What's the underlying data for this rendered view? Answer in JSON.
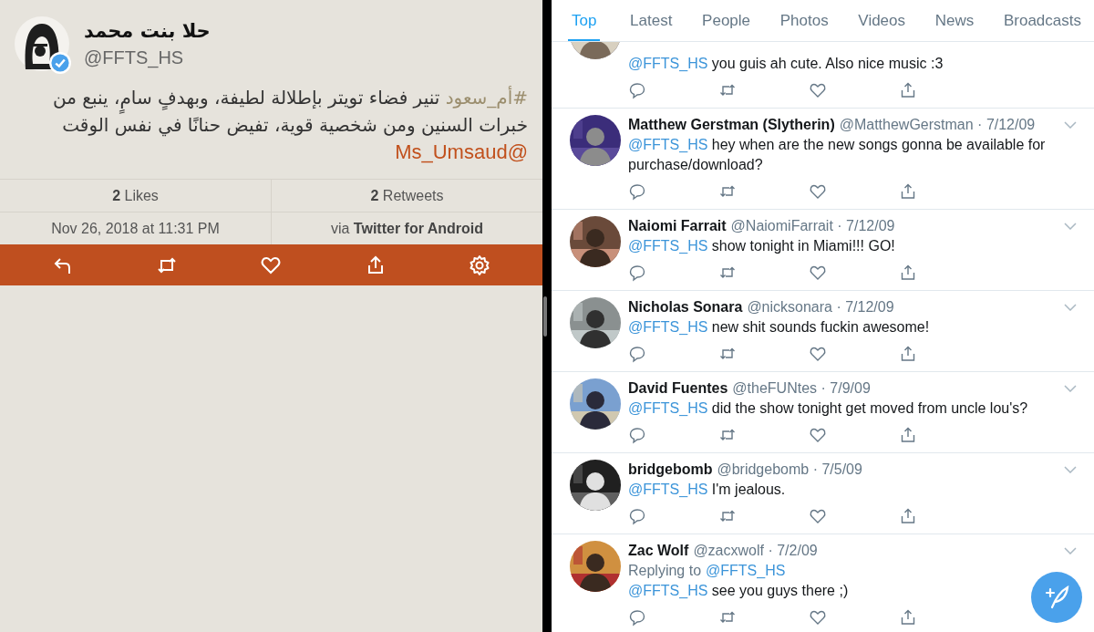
{
  "detail": {
    "name": "حلا بنت محمد",
    "handle": "@FFTS_HS",
    "verified": true,
    "hashtag": "#أم_سعود",
    "text": "تنير فضاء تويتر بإطلالة لطيفة، وبهدفٍ سامٍ، ينبع من خبرات السنين ومن شخصية قوية، تفيض حنانًا في نفس الوقت",
    "mention": "@Ms_Umsaud",
    "likes_count": "2",
    "likes_label": "Likes",
    "retweets_count": "2",
    "retweets_label": "Retweets",
    "timestamp": "Nov 26, 2018 at 11:31 PM",
    "via": "via",
    "source": "Twitter for Android"
  },
  "tabs": [
    {
      "label": "Top",
      "selected": true
    },
    {
      "label": "Latest",
      "selected": false
    },
    {
      "label": "People",
      "selected": false
    },
    {
      "label": "Photos",
      "selected": false
    },
    {
      "label": "Videos",
      "selected": false
    },
    {
      "label": "News",
      "selected": false
    },
    {
      "label": "Broadcasts",
      "selected": false
    }
  ],
  "tweets": [
    {
      "mention": "@FFTS_HS",
      "text": "you guis ah cute. Also nice music :3"
    },
    {
      "name": "Matthew Gerstman (Slytherin)",
      "handle": "@MatthewGerstman",
      "separator": " · ",
      "date": "7/12/09",
      "mention": "@FFTS_HS",
      "text": "hey when are the new songs gonna be available for purchase/download?"
    },
    {
      "name": "Naiomi Farrait",
      "handle": "@NaiomiFarrait",
      "separator": " · ",
      "date": "7/12/09",
      "mention": "@FFTS_HS",
      "text": "show tonight in Miami!!! GO!"
    },
    {
      "name": "Nicholas Sonara",
      "handle": "@nicksonara",
      "separator": " · ",
      "date": "7/12/09",
      "mention": "@FFTS_HS",
      "text": "new shit sounds fuckin awesome!"
    },
    {
      "name": "David Fuentes",
      "handle": "@theFUNtes",
      "separator": " · ",
      "date": "7/9/09",
      "mention": "@FFTS_HS",
      "text": "did the show tonight get moved from uncle lou's?"
    },
    {
      "name": "bridgebomb",
      "handle": "@bridgebomb",
      "separator": " · ",
      "date": "7/5/09",
      "mention": "@FFTS_HS",
      "text": "I'm jealous."
    },
    {
      "name": "Zac Wolf",
      "handle": "@zacxwolf",
      "separator": " · ",
      "date": "7/2/09",
      "replying_label": "Replying to",
      "replying_to": "@FFTS_HS",
      "mention": "@FFTS_HS",
      "text": "see you guys there ;)"
    }
  ]
}
